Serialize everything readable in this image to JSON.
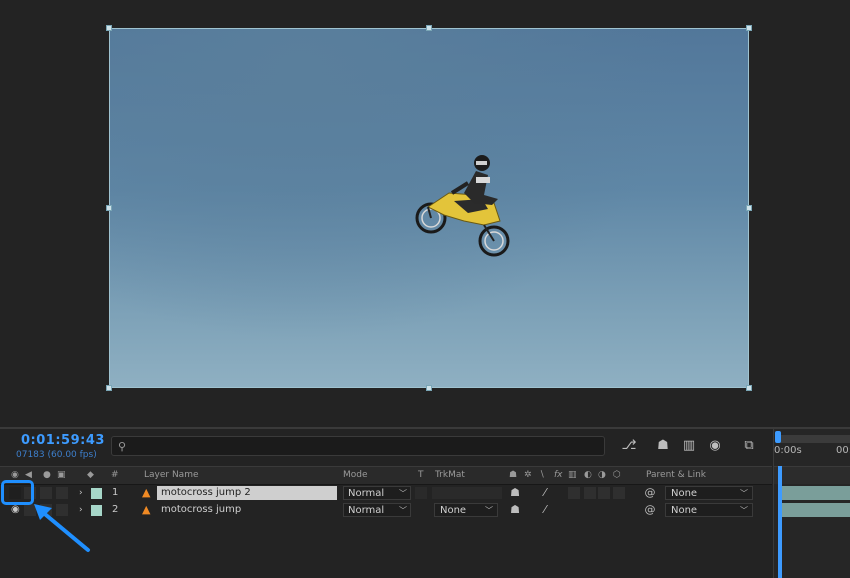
{
  "timeline": {
    "timecode": "0:01:59:43",
    "frames": "07183 (60.00 fps)",
    "search_glyph": "⚲",
    "search_placeholder": "",
    "header": {
      "layer_name": "Layer Name",
      "mode": "Mode",
      "t": "T",
      "trkmat": "TrkMat",
      "parent_link": "Parent & Link",
      "number": "#",
      "fx": "fx"
    },
    "layers": [
      {
        "number": "1",
        "name": "motocross jump 2",
        "mode": "Normal",
        "trkmat": "",
        "parent": "None",
        "selected": true
      },
      {
        "number": "2",
        "name": "motocross jump",
        "mode": "Normal",
        "trkmat": "None",
        "parent": "None",
        "selected": false
      }
    ],
    "ruler_labels": [
      "0:00s",
      "00:"
    ]
  },
  "colors": {
    "accent": "#3d9bff",
    "label_chip": "#a6d6c8",
    "highlight": "#1f8fff"
  },
  "icons": {
    "search": "search-icon",
    "eye": "eye-icon",
    "audio": "speaker-icon",
    "solo": "solo-dot-icon",
    "lock": "lock-icon",
    "label": "tag-icon",
    "source": "vlc-cone-icon"
  }
}
